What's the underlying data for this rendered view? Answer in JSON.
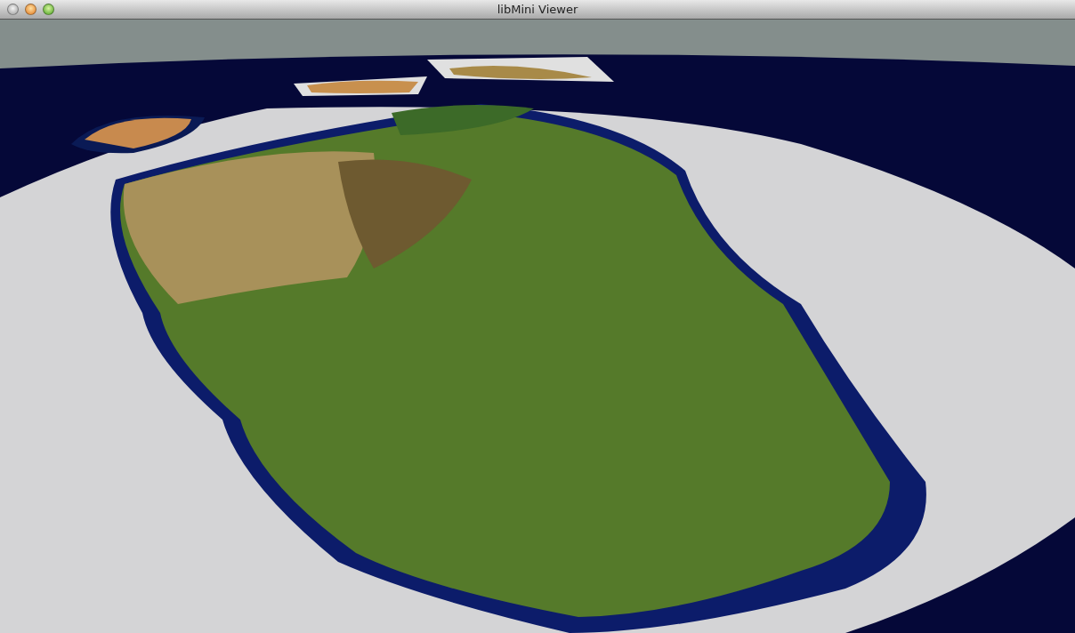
{
  "window": {
    "title": "libMini Viewer"
  }
}
